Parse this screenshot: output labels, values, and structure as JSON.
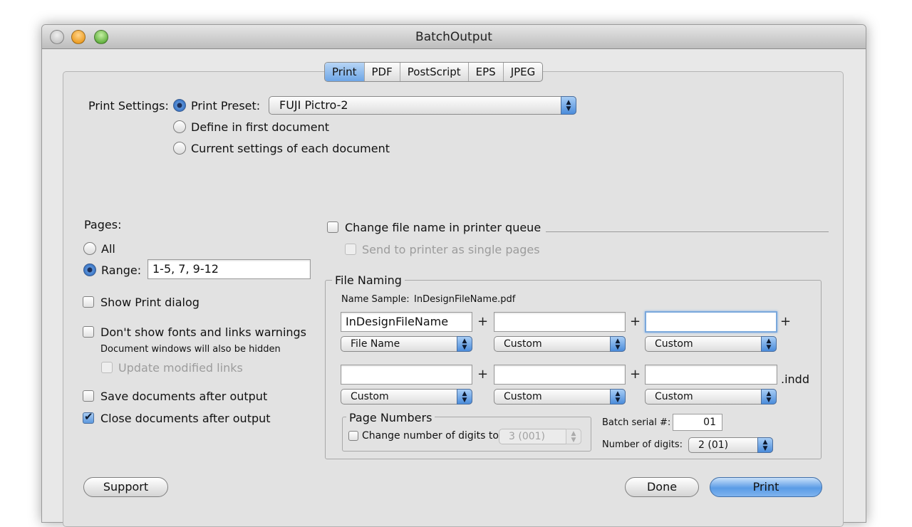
{
  "window": {
    "title": "BatchOutput"
  },
  "tabs": [
    {
      "label": "Print",
      "active": true
    },
    {
      "label": "PDF",
      "active": false
    },
    {
      "label": "PostScript",
      "active": false
    },
    {
      "label": "EPS",
      "active": false
    },
    {
      "label": "JPEG",
      "active": false
    }
  ],
  "print_settings": {
    "label": "Print Settings:",
    "options": [
      "Print Preset:",
      "Define in first document",
      "Current settings of each document"
    ],
    "selected": "Print Preset:",
    "preset_value": "FUJI Pictro-2"
  },
  "pages": {
    "label": "Pages:",
    "all_label": "All",
    "range_label": "Range:",
    "selected": "Range:",
    "range_value": "1-5, 7, 9-12"
  },
  "options": {
    "show_print_dialog": {
      "label": "Show Print dialog",
      "checked": false
    },
    "dont_show_warnings": {
      "label": "Don't show fonts and links warnings",
      "checked": false
    },
    "hidden_note": "Document windows will also be hidden",
    "update_links": {
      "label": "Update modified links",
      "checked": false,
      "enabled": false
    },
    "save_after": {
      "label": "Save documents after output",
      "checked": false
    },
    "close_after": {
      "label": "Close documents after output",
      "checked": true
    }
  },
  "printer_queue": {
    "change_label": "Change file name in printer queue",
    "change_checked": false,
    "single_pages_label": "Send to printer as single pages",
    "single_pages_enabled": false
  },
  "file_naming": {
    "legend": "File Naming",
    "sample_label": "Name Sample:",
    "sample_value": "InDesignFileName.pdf",
    "plus": "+",
    "extension": ".indd",
    "fields": [
      "InDesignFileName",
      "",
      "",
      "",
      "",
      ""
    ],
    "selectors": [
      "File Name",
      "Custom",
      "Custom",
      "Custom",
      "Custom",
      "Custom"
    ],
    "page_numbers": {
      "legend": "Page Numbers",
      "change_label": "Change number of digits to:",
      "change_checked": false,
      "digits_value": "3 (001)"
    },
    "batch_serial_label": "Batch serial #:",
    "batch_serial_value": "01",
    "number_digits_label": "Number of digits:",
    "number_digits_value": "2 (01)"
  },
  "buttons": {
    "support": "Support",
    "done": "Done",
    "print": "Print"
  },
  "icons": {
    "popup_arrows": "up-down-arrows-icon",
    "checkmark": "checkmark-icon"
  }
}
